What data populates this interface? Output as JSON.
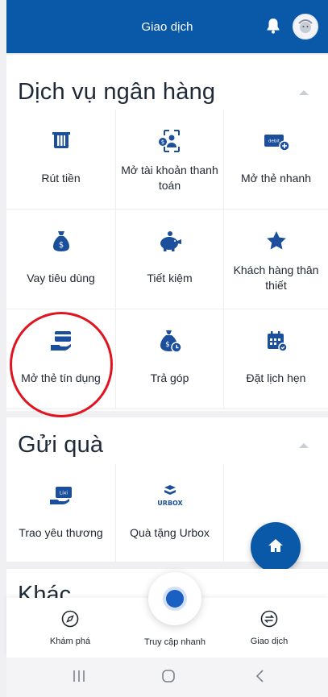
{
  "header": {
    "title": "Giao dịch",
    "bell_icon": "bell-icon",
    "avatar_icon": "avatar-icon"
  },
  "banking": {
    "title": "Dịch vụ ngân hàng",
    "items": [
      {
        "label": "Rút tiền",
        "icon": "atm-icon"
      },
      {
        "label": "Mở tài khoản thanh toán",
        "icon": "open-account-icon"
      },
      {
        "label": "Mở thẻ nhanh",
        "icon": "debit-card-icon"
      },
      {
        "label": "Vay tiêu dùng",
        "icon": "money-bag-icon"
      },
      {
        "label": "Tiết kiệm",
        "icon": "piggy-bank-icon"
      },
      {
        "label": "Khách hàng thân thiết",
        "icon": "star-icon"
      },
      {
        "label": "Mở thẻ tín dụng",
        "icon": "credit-card-hand-icon"
      },
      {
        "label": "Trả góp",
        "icon": "installment-icon"
      },
      {
        "label": "Đặt lịch hẹn",
        "icon": "calendar-icon"
      }
    ]
  },
  "gift": {
    "title": "Gửi quà",
    "items": [
      {
        "label": "Trao yêu thương",
        "icon": "lixi-icon",
        "icon_text": "Lixi"
      },
      {
        "label": "Quà tặng Urbox",
        "icon": "urbox-icon",
        "icon_text": "URBOX"
      }
    ]
  },
  "other": {
    "title": "Khác"
  },
  "bottom_nav": {
    "explore": "Khám phá",
    "quick": "Truy cập nhanh",
    "transactions": "Giao dịch"
  },
  "colors": {
    "primary": "#0a58a8",
    "highlight": "#e0131f",
    "background": "#f0f0f2"
  }
}
